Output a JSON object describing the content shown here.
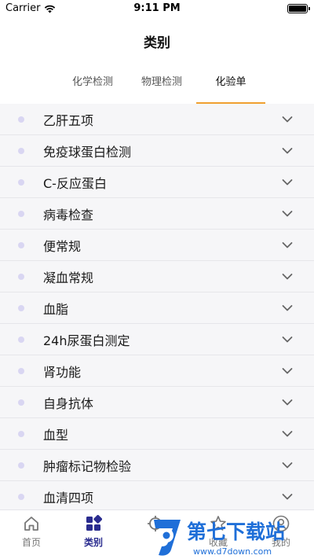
{
  "status": {
    "carrier": "Carrier",
    "time": "9:11 PM"
  },
  "header": {
    "title": "类别"
  },
  "tabs": [
    {
      "label": "化学检测",
      "active": false
    },
    {
      "label": "物理检测",
      "active": false
    },
    {
      "label": "化验单",
      "active": true
    }
  ],
  "list": [
    {
      "label": "乙肝五项"
    },
    {
      "label": "免疫球蛋白检测"
    },
    {
      "label": "C-反应蛋白"
    },
    {
      "label": "病毒检查"
    },
    {
      "label": "便常规"
    },
    {
      "label": "凝血常规"
    },
    {
      "label": "血脂"
    },
    {
      "label": "24h尿蛋白测定"
    },
    {
      "label": "肾功能"
    },
    {
      "label": "自身抗体"
    },
    {
      "label": "血型"
    },
    {
      "label": "肿瘤标记物检验"
    },
    {
      "label": "血清四项"
    }
  ],
  "tabbar": {
    "home": "首页",
    "category": "类别",
    "favorites": "收藏",
    "profile": "我的"
  },
  "watermark": {
    "brand": "第七下载站",
    "url": "www.d7down.com"
  },
  "colors": {
    "accent": "#f0a030",
    "active_tab": "#2a2c8f",
    "dot": "#d9d6f2",
    "watermark": "#1f6fd8"
  }
}
